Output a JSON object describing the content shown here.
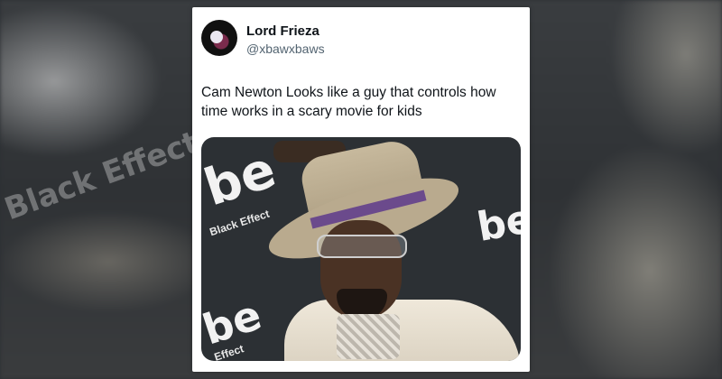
{
  "tweet": {
    "author": {
      "display_name": "Lord Frieza",
      "handle": "@xbawxbaws"
    },
    "text": "Cam Newton Looks like a guy that controls how time works in a scary movie for kids",
    "media": {
      "logo_main": "be",
      "logo_caption": "Black Effect",
      "logo_caption_short": "Effect"
    }
  },
  "background": {
    "ghost_text": "Black Effect"
  },
  "colors": {
    "card_bg": "#ffffff",
    "text_primary": "#0f1419",
    "text_secondary": "#536471",
    "backdrop": "#2b2f33"
  }
}
